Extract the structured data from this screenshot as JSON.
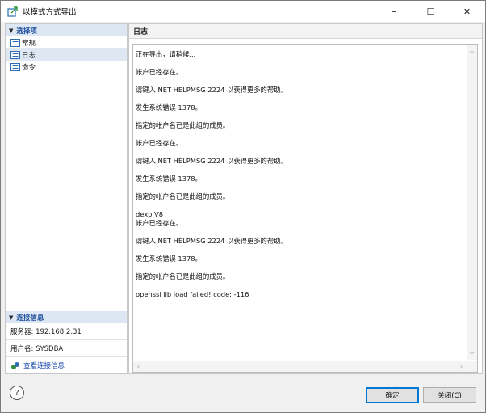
{
  "window": {
    "title": "以模式方式导出",
    "minimize": "–",
    "maximize": "☐",
    "close": "✕"
  },
  "sidebar": {
    "section_label": "选择项",
    "items": [
      {
        "label": "常规",
        "icon": "list-icon"
      },
      {
        "label": "日志",
        "icon": "list-icon",
        "selected": true
      },
      {
        "label": "命令",
        "icon": "list-icon"
      }
    ]
  },
  "connection": {
    "section_label": "连接信息",
    "server": "服务器: 192.168.2.31",
    "user": "用户名: SYSDBA",
    "view_link": "查看连接信息"
  },
  "log": {
    "header": "日志",
    "lines": [
      "正在导出，请稍候...",
      "",
      "帐户已经存在。",
      "",
      "请键入 NET HELPMSG 2224 以获得更多的帮助。",
      "",
      "发生系统错误 1378。",
      "",
      "指定的帐户名已是此组的成员。",
      "",
      "帐户已经存在。",
      "",
      "请键入 NET HELPMSG 2224 以获得更多的帮助。",
      "",
      "发生系统错误 1378。",
      "",
      "指定的帐户名已是此组的成员。",
      "",
      "dexp V8",
      "帐户已经存在。",
      "",
      "请键入 NET HELPMSG 2224 以获得更多的帮助。",
      "",
      "发生系统错误 1378。",
      "",
      "指定的帐户名已是此组的成员。",
      "",
      "openssl lib load failed! code: -116"
    ]
  },
  "footer": {
    "help": "?",
    "ok": "确定",
    "close": "关闭(C)"
  },
  "colors": {
    "accent": "#0078d7",
    "section_text": "#1c4e9c",
    "link": "#0b3ea8"
  }
}
